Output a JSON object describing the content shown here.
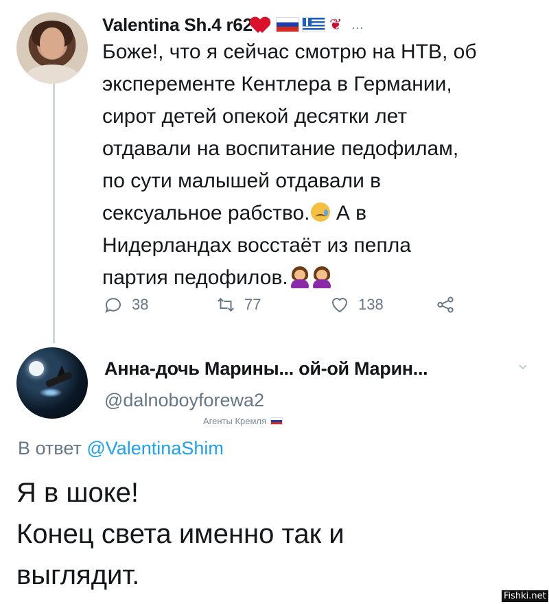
{
  "tweet1": {
    "display_name": "Valentina Sh.4 r62",
    "name_decorations": [
      "heart-emoji",
      "russia-flag-emoji",
      "greece-flag-emoji",
      "rose-emoji"
    ],
    "more_label": "...",
    "text_lines": [
      "Боже!, что я сейчас смотрю на НТВ, об",
      "эксперементе Кентлера в Германии,",
      "сирот детей опекой десятки лет",
      "отдавали на воспитание педофилам,",
      "по сути малышей отдавали в",
      "сексуальное рабство.",
      "А в",
      "Нидерландах восстаёт из пепла",
      "партия педофилов."
    ],
    "actions": {
      "reply_count": "38",
      "retweet_count": "77",
      "like_count": "138"
    }
  },
  "tweet2": {
    "display_name": "Анна-дочь Марины... ой-ой Марин...",
    "handle": "@dalnoboyforewa2",
    "badge_text": "Агенты Кремля",
    "reply_prefix": "В ответ",
    "reply_to_handle": "@ValentinaShim",
    "text_lines": [
      "Я в шоке!",
      "Конец света именно так и",
      "выглядит."
    ]
  },
  "watermark": "Fishki.net",
  "colors": {
    "text": "#14171a",
    "secondary": "#657786",
    "link": "#1da1f2",
    "thread_line": "#ccd6dd"
  }
}
